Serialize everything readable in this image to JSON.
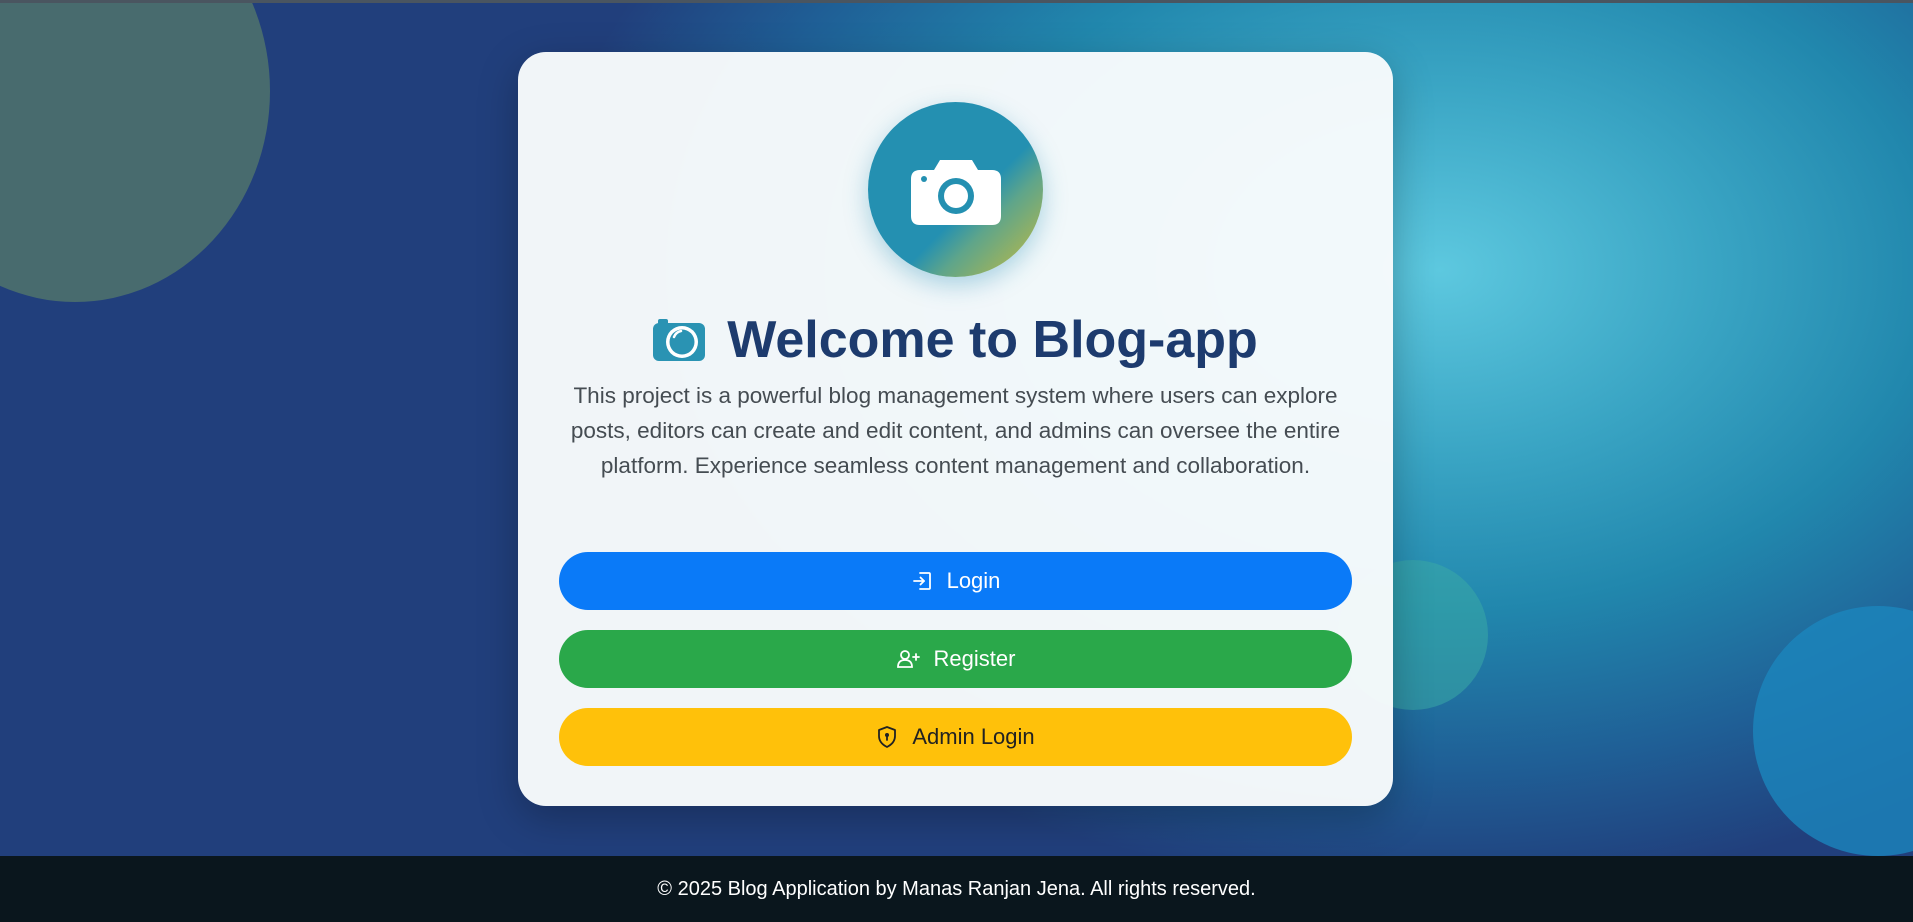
{
  "hero": {
    "title": "Welcome to Blog-app",
    "description": "This project is a powerful blog management system where users can explore posts, editors can create and edit content, and admins can oversee the entire platform. Experience seamless content management and collaboration.",
    "logo_icon": "camera-icon",
    "title_icon": "camera-retro-icon"
  },
  "buttons": {
    "login": {
      "label": "Login",
      "icon": "sign-in-icon",
      "color": "#0a7af8"
    },
    "register": {
      "label": "Register",
      "icon": "person-plus-icon",
      "color": "#2aa84a"
    },
    "admin": {
      "label": "Admin Login",
      "icon": "shield-lock-icon",
      "color": "#ffc10a"
    }
  },
  "footer": {
    "text": "© 2025 Blog Application by Manas Ranjan Jena. All rights reserved."
  },
  "colors": {
    "title": "#1d3b6e",
    "accent": "#2490b1",
    "footer_bg": "#0a161d"
  }
}
